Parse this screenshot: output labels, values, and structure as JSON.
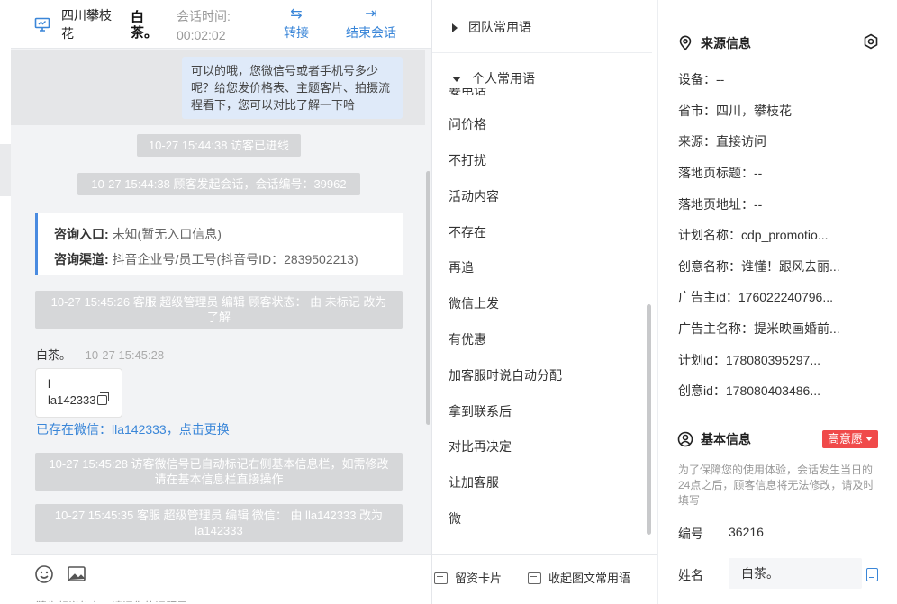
{
  "header": {
    "customer_name": "四川攀枝花",
    "nickname": "白茶。",
    "session_time_label": "会话时间:",
    "session_time": "00:02:02",
    "transfer_label": "转接",
    "end_label": "结束会话"
  },
  "chat": {
    "outgoing_message": "可以的哦，您微信号或者手机号多少呢？给您发价格表、主题客片、拍摄流程看下，您可以对比了解一下哈",
    "system_messages": [
      "10-27 15:44:38 访客已进线",
      "10-27 15:44:38 顾客发起会话，会话编号：39962",
      "10-27 15:45:26 客服 超级管理员 编辑 顾客状态： 由 未标记 改为 了解",
      "10-27 15:45:28 访客微信号已自动标记右侧基本信息栏，如需修改请在基本信息栏直接操作",
      "10-27 15:45:35 客服 超级管理员 编辑 微信： 由 lla142333 改为 la142333"
    ],
    "entry_label": "咨询入口:",
    "entry_value": "未知(暂无入口信息)",
    "channel_label": "咨询渠道:",
    "channel_value": "抖音企业号/员工号(抖音号ID：2839502213)",
    "sender": "白茶。",
    "sender_time": "10-27 15:45:28",
    "incoming_line1": "l",
    "incoming_line2": "la142333",
    "wechat_link": "已存在微信：lla142333，点击更换",
    "input_hint": "猜你想说的有：请问您的问题是..."
  },
  "phrases": {
    "team_group": "团队常用语",
    "personal_group": "个人常用语",
    "cut_item": "要电话",
    "items": [
      "问价格",
      "不打扰",
      "活动内容",
      "不存在",
      "再追",
      "微信上发",
      "有优惠",
      "加客服时说自动分配",
      "拿到联系后",
      "对比再决定",
      "让加客服",
      "微"
    ],
    "footer_card": "留资卡片",
    "footer_collapse": "收起图文常用语"
  },
  "source_info": {
    "title": "来源信息",
    "rows": [
      "设备：--",
      "省市：四川，攀枝花",
      "来源：直接访问",
      "落地页标题：--",
      "落地页地址：--",
      "计划名称：cdp_promotio...",
      "创意名称：谁懂！跟风去丽...",
      "广告主id：176022240796...",
      "广告主名称：提米映画婚前...",
      "计划id：178080395297...",
      "创意id：178080403486..."
    ]
  },
  "basic_info": {
    "title": "基本信息",
    "intent_badge": "高意愿",
    "notice": "为了保障您的使用体验，会话发生当日的24点之后，顾客信息将无法修改，请及时填写",
    "id_label": "编号",
    "id_value": "36216",
    "name_label": "姓名",
    "name_value": "白茶。"
  }
}
